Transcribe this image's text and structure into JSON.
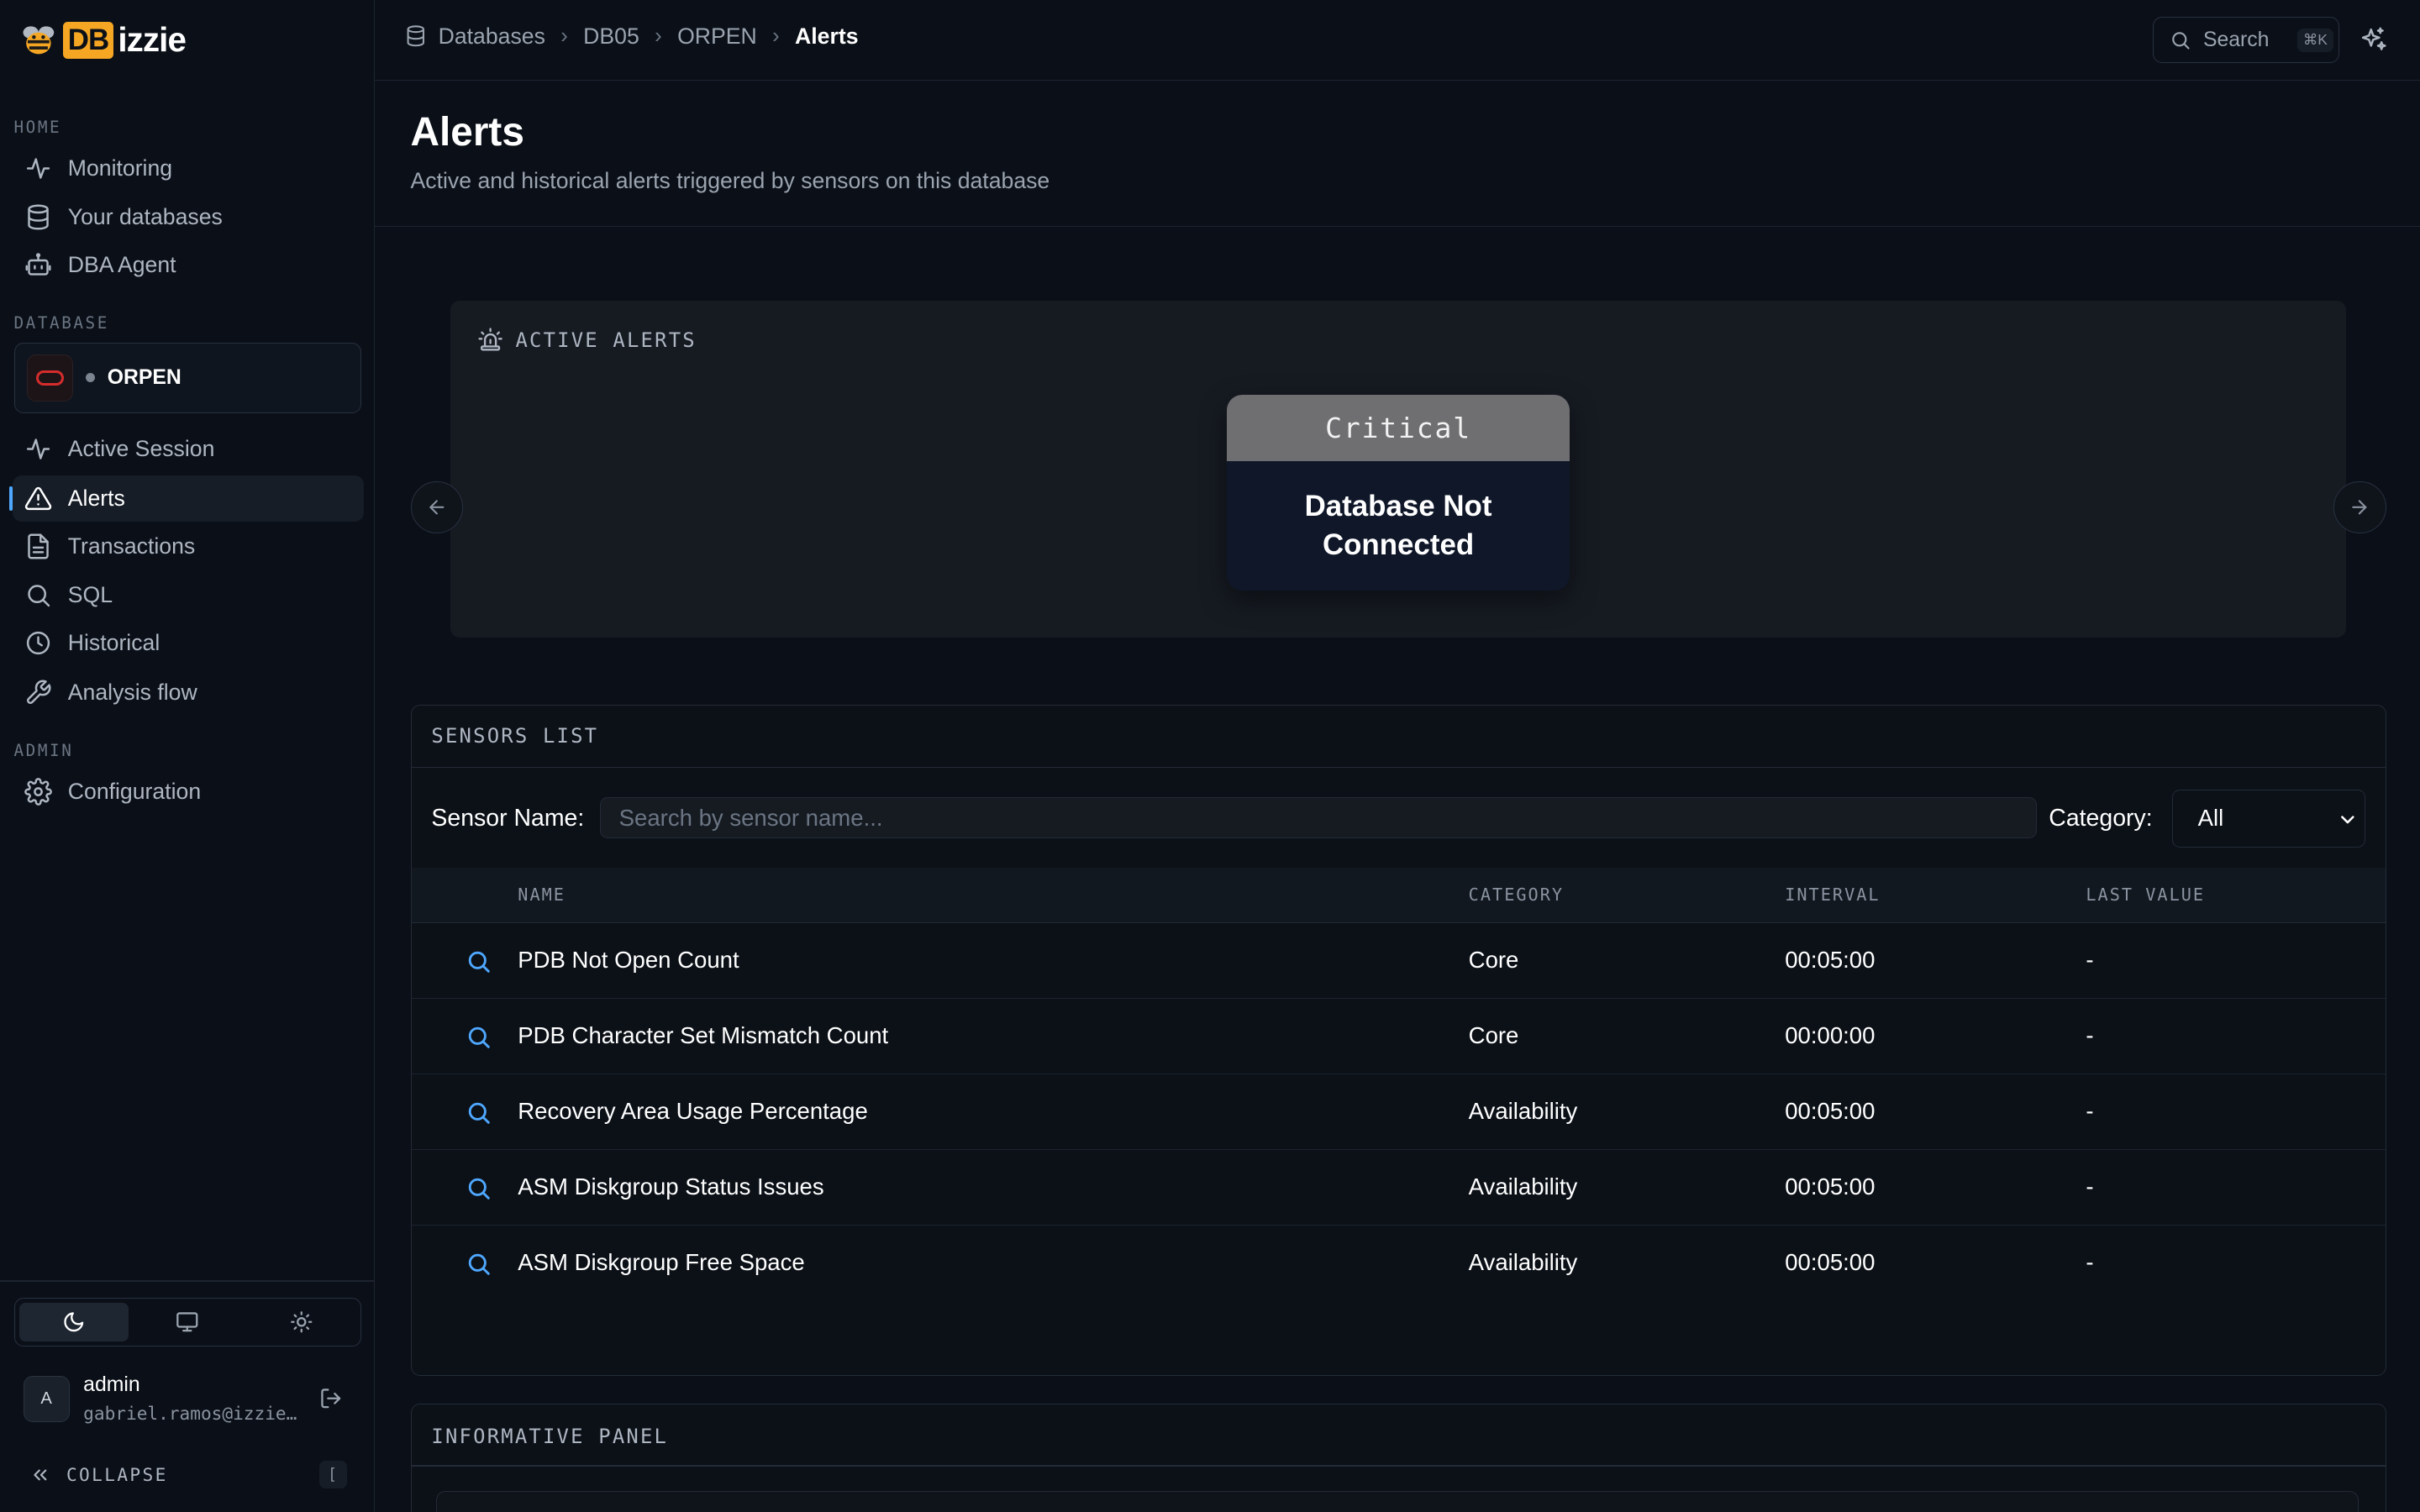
{
  "app": {
    "logo_db": "DB",
    "logo_rest": "izzie"
  },
  "sidebar": {
    "home_label": "HOME",
    "home_items": [
      {
        "label": "Monitoring",
        "icon": "activity-icon"
      },
      {
        "label": "Your databases",
        "icon": "database-icon"
      },
      {
        "label": "DBA Agent",
        "icon": "bot-icon"
      }
    ],
    "database_label": "DATABASE",
    "database": {
      "name": "ORPEN",
      "status_color": "#7b8591",
      "brand_color": "#d62c2c"
    },
    "db_items": [
      {
        "label": "Active Session",
        "icon": "activity-icon"
      },
      {
        "label": "Alerts",
        "icon": "alert-triangle-icon",
        "active": true
      },
      {
        "label": "Transactions",
        "icon": "file-text-icon"
      },
      {
        "label": "SQL",
        "icon": "search-icon"
      },
      {
        "label": "Historical",
        "icon": "clock-icon"
      },
      {
        "label": "Analysis flow",
        "icon": "wrench-icon"
      }
    ],
    "admin_label": "ADMIN",
    "admin_items": [
      {
        "label": "Configuration",
        "icon": "gear-icon"
      }
    ],
    "theme_selected": "dark",
    "user": {
      "initial": "A",
      "name": "admin",
      "email": "gabriel.ramos@izzie..."
    },
    "collapse_label": "COLLAPSE",
    "collapse_key": "["
  },
  "topbar": {
    "breadcrumbs": [
      "Databases",
      "DB05",
      "ORPEN",
      "Alerts"
    ],
    "search_label": "Search",
    "search_shortcut": "⌘K"
  },
  "page": {
    "title": "Alerts",
    "subtitle": "Active and historical alerts triggered by sensors on this database"
  },
  "active_alerts": {
    "label": "ACTIVE ALERTS",
    "cards": [
      {
        "severity": "Critical",
        "message": "Database Not Connected",
        "severity_color": "#6f6f72"
      }
    ]
  },
  "sensors": {
    "label": "SENSORS LIST",
    "name_filter_label": "Sensor Name:",
    "name_filter_placeholder": "Search by sensor name...",
    "category_filter_label": "Category:",
    "category_selected": "All",
    "columns": [
      "NAME",
      "CATEGORY",
      "INTERVAL",
      "LAST VALUE"
    ],
    "rows": [
      {
        "name": "PDB Not Open Count",
        "category": "Core",
        "interval": "00:05:00",
        "last_value": "-"
      },
      {
        "name": "PDB Character Set Mismatch Count",
        "category": "Core",
        "interval": "00:00:00",
        "last_value": "-"
      },
      {
        "name": "Recovery Area Usage Percentage",
        "category": "Availability",
        "interval": "00:05:00",
        "last_value": "-"
      },
      {
        "name": "ASM Diskgroup Status Issues",
        "category": "Availability",
        "interval": "00:05:00",
        "last_value": "-"
      },
      {
        "name": "ASM Diskgroup Free Space",
        "category": "Availability",
        "interval": "00:05:00",
        "last_value": "-"
      }
    ]
  },
  "info_panel": {
    "label": "INFORMATIVE PANEL"
  },
  "colors": {
    "accent": "#4fa8ff",
    "brand": "#f5a623",
    "background": "#0b1018"
  }
}
